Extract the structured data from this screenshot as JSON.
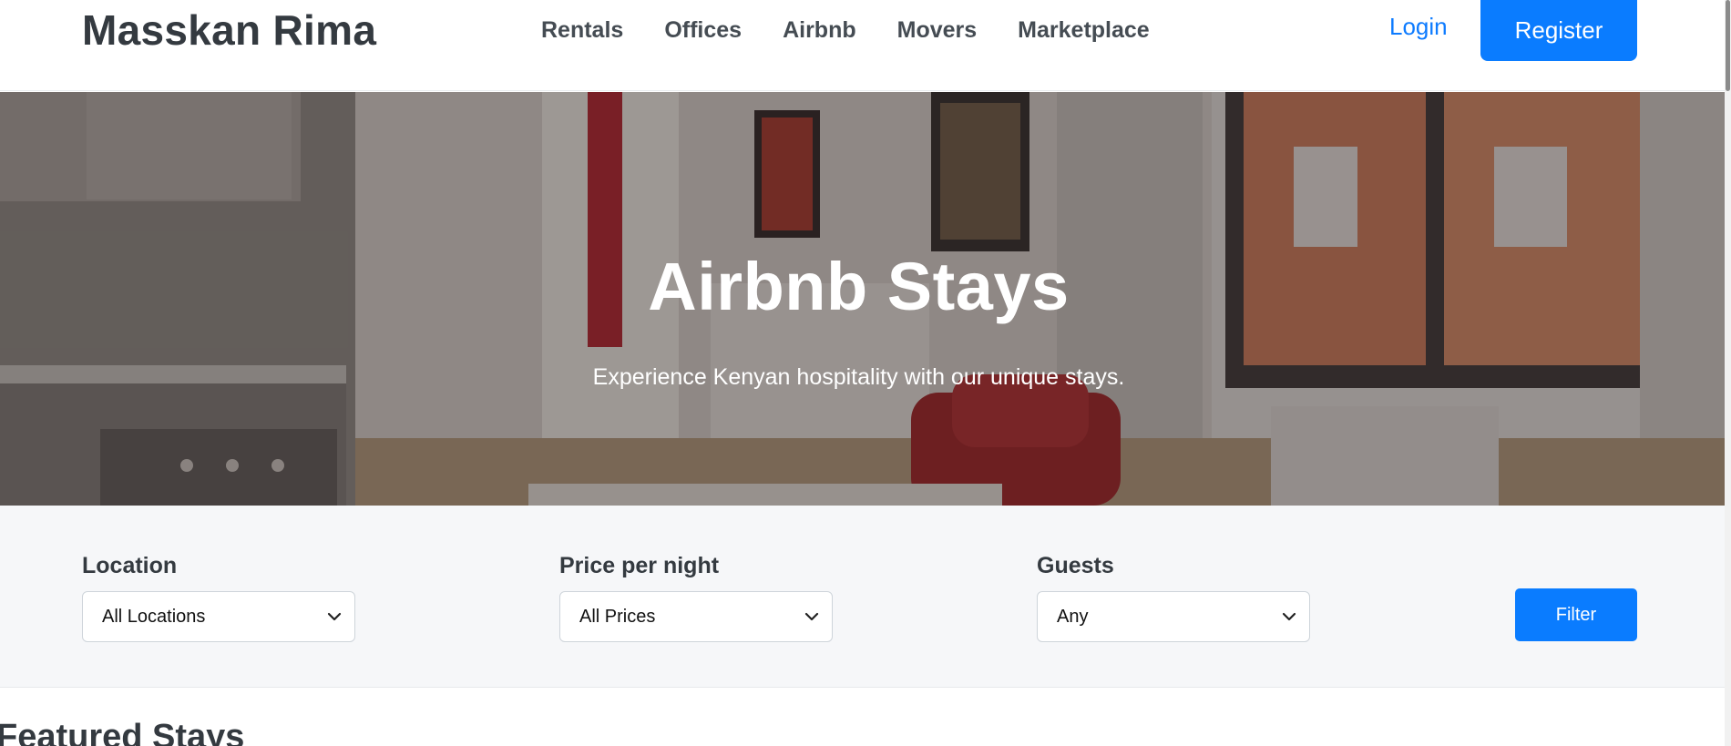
{
  "header": {
    "brand": "Masskan Rima",
    "nav": [
      {
        "label": "Rentals"
      },
      {
        "label": "Offices"
      },
      {
        "label": "Airbnb"
      },
      {
        "label": "Movers"
      },
      {
        "label": "Marketplace"
      }
    ],
    "login_label": "Login",
    "register_label": "Register"
  },
  "hero": {
    "title": "Airbnb Stays",
    "subtitle": "Experience Kenyan hospitality with our unique stays."
  },
  "filters": {
    "location": {
      "label": "Location",
      "value": "All Locations"
    },
    "price": {
      "label": "Price per night",
      "value": "All Prices"
    },
    "guests": {
      "label": "Guests",
      "value": "Any"
    },
    "button_label": "Filter"
  },
  "featured": {
    "title": "Featured Stays"
  },
  "colors": {
    "accent": "#0a7cff",
    "text_dark": "#343a40",
    "filter_bg": "#f6f7f9"
  }
}
